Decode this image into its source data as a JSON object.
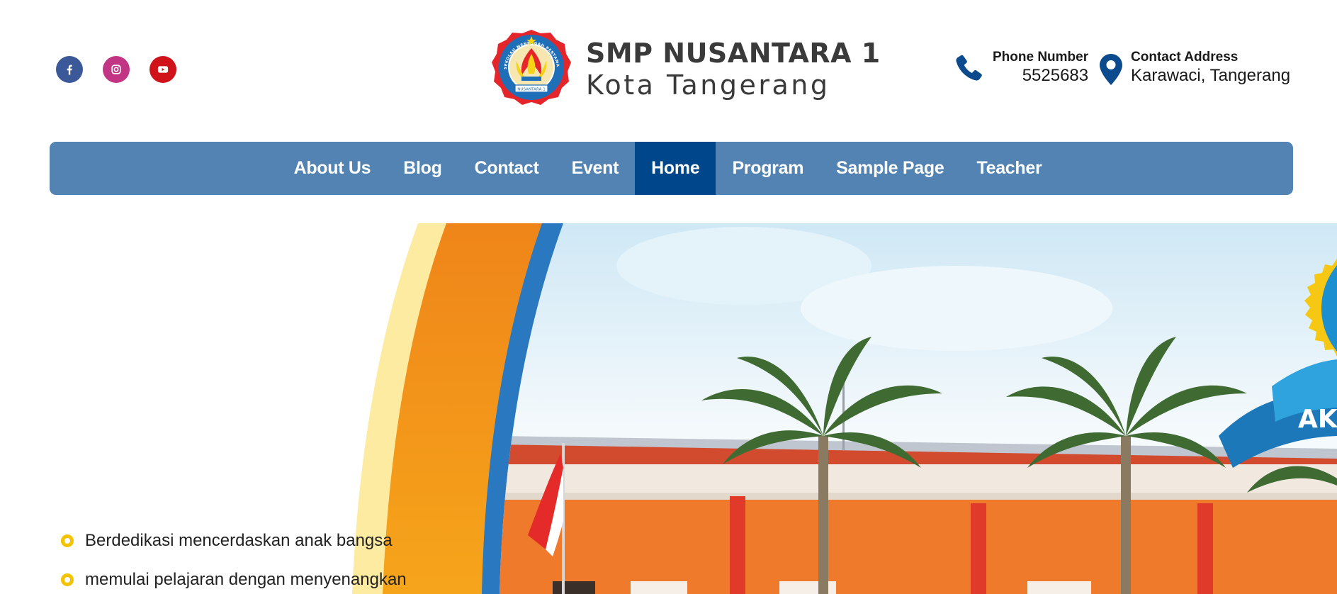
{
  "social": [
    {
      "name": "facebook-icon",
      "color": "#3b5998"
    },
    {
      "name": "instagram-icon",
      "color": "#c13584"
    },
    {
      "name": "youtube-icon",
      "color": "#d0121a"
    }
  ],
  "logo": {
    "line1": "SMP NUSANTARA 1",
    "line2": "Kota Tangerang",
    "emblem_ring_text": "SEKOLAH MENENGAH PERTAMA",
    "emblem_banner_text": "NUSANTARA 1"
  },
  "contact": {
    "phone": {
      "label": "Phone Number",
      "value": "5525683",
      "icon": "phone-icon"
    },
    "address": {
      "label": "Contact Address",
      "value": "Karawaci, Tangerang",
      "icon": "map-pin-icon"
    }
  },
  "nav": {
    "items": [
      {
        "label": "About Us"
      },
      {
        "label": "Blog"
      },
      {
        "label": "Contact"
      },
      {
        "label": "Event"
      },
      {
        "label": "Home"
      },
      {
        "label": "Program"
      },
      {
        "label": "Sample Page"
      },
      {
        "label": "Teacher"
      }
    ],
    "active": "Home"
  },
  "hero": {
    "badge_text": "AK",
    "bullets": [
      "Berdedikasi mencerdaskan anak bangsa",
      "memulai pelajaran dengan menyenangkan"
    ]
  },
  "colors": {
    "nav_bg": "#5283b3",
    "nav_active": "#00468b",
    "brand_blue": "#0b4a8c",
    "bullet_yellow": "#f5c200",
    "arc_orange": "#f08a1c",
    "arc_blue": "#2a78c0"
  }
}
